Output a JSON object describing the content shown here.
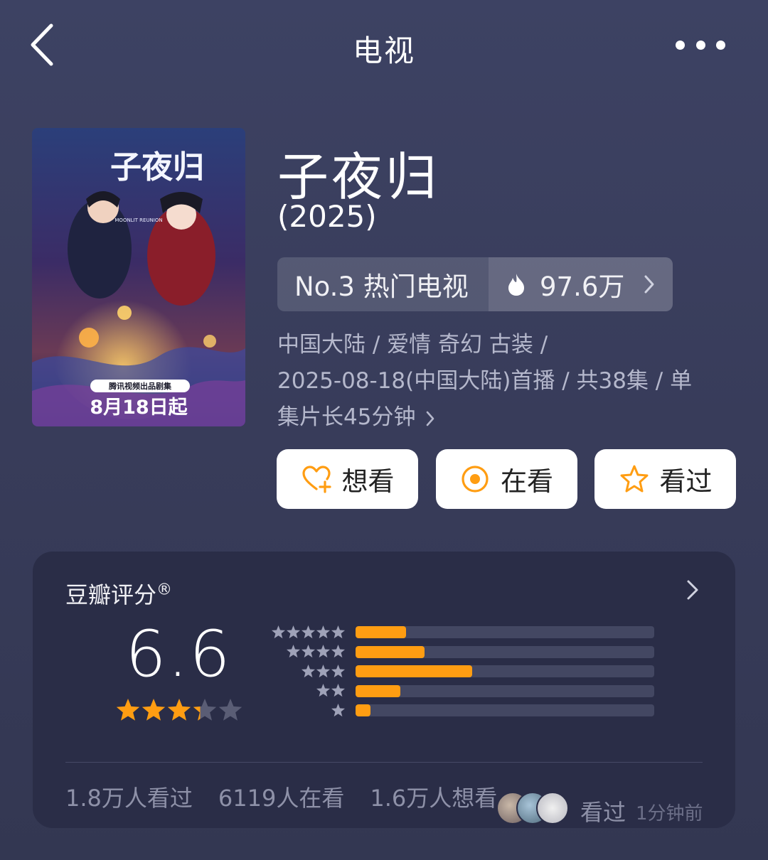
{
  "nav": {
    "title": "电视",
    "back_icon": "back-chevron-icon",
    "more_icon": "more-dots-icon"
  },
  "show": {
    "title": "子夜归",
    "year": "(2025)",
    "poster": {
      "title_art": "子夜归",
      "subtitle_en": "MOONLIT REUNION",
      "producer": "腾讯视频出品剧集",
      "premiere": "8月18日起"
    },
    "rank_label": "No.3 热门电视",
    "heat_value": "97.6万",
    "meta_line1": "中国大陆 / 爱情 奇幻 古装 /",
    "meta_line2": "2025-08-18(中国大陆)首播 / 共38集 / 单",
    "meta_line3": "集片长45分钟"
  },
  "actions": {
    "want": "想看",
    "watching": "在看",
    "watched": "看过"
  },
  "rating": {
    "title": "豆瓣评分",
    "registered": "®",
    "score": "6.6",
    "stars_value": 3.3,
    "distribution": [
      {
        "stars": 5,
        "percent": 17
      },
      {
        "stars": 4,
        "percent": 23
      },
      {
        "stars": 3,
        "percent": 39
      },
      {
        "stars": 2,
        "percent": 15
      },
      {
        "stars": 1,
        "percent": 5
      }
    ],
    "watched_count": "1.8万人看过",
    "watching_count": "6119人在看",
    "want_count": "1.6万人想看",
    "friend_status": "看过",
    "friend_time": "1分钟前"
  },
  "colors": {
    "accent": "#ff9d12",
    "background": "#3a3e5e",
    "card": "#2a2d47"
  }
}
